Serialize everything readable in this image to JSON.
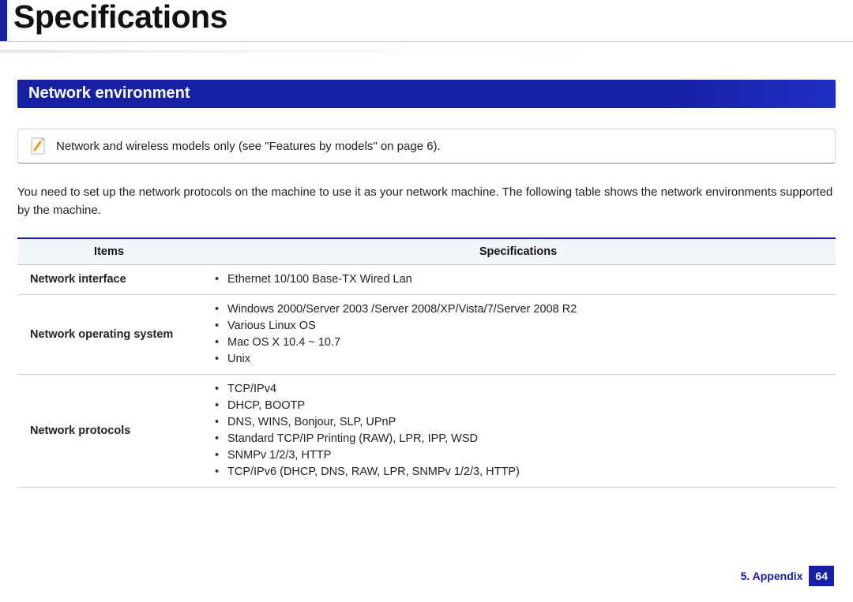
{
  "page": {
    "title": "Specifications",
    "section_heading": "Network environment",
    "note_text": "Network and wireless models only (see \"Features by models\" on page 6).",
    "intro_text": "You need to set up the network protocols on the machine to use it as your network machine. The following table shows the network environments supported by the machine."
  },
  "table": {
    "headers": {
      "col1": "Items",
      "col2": "Specifications"
    },
    "rows": [
      {
        "item": "Network interface",
        "specs": [
          "Ethernet 10/100 Base-TX Wired Lan"
        ]
      },
      {
        "item": "Network operating system",
        "specs": [
          "Windows 2000/Server 2003 /Server 2008/XP/Vista/7/Server 2008 R2",
          "Various Linux OS",
          "Mac OS X 10.4 ~ 10.7",
          "Unix"
        ]
      },
      {
        "item": "Network protocols",
        "specs": [
          "TCP/IPv4",
          "DHCP, BOOTP",
          "DNS, WINS, Bonjour, SLP, UPnP",
          "Standard TCP/IP Printing (RAW), LPR, IPP, WSD",
          "SNMPv 1/2/3, HTTP",
          "TCP/IPv6 (DHCP, DNS, RAW, LPR, SNMPv 1/2/3, HTTP)"
        ]
      }
    ]
  },
  "footer": {
    "chapter_label": "5. Appendix",
    "page_number": "64"
  }
}
